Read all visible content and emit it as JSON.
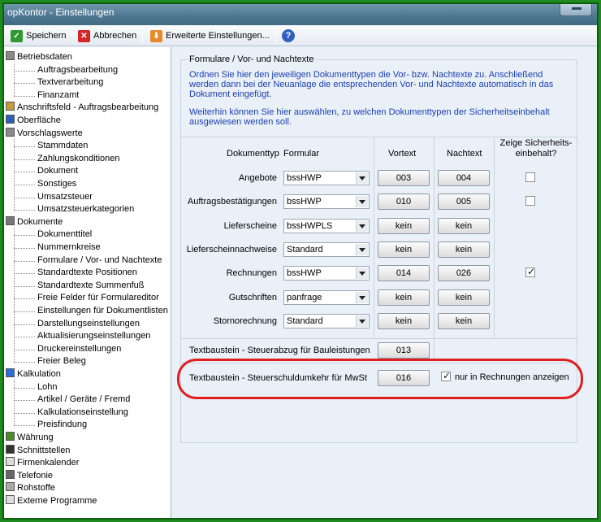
{
  "window": {
    "title": "opKontor - Einstellungen"
  },
  "toolbar": {
    "save_label": "Speichern",
    "cancel_label": "Abbrechen",
    "advanced_label": "Erweiterte Einstellungen...",
    "help_icon": "?"
  },
  "tree": {
    "items": [
      {
        "label": "Betriebsdaten"
      },
      {
        "label": "Auftragsbearbeitung"
      },
      {
        "label": "Textverarbeitung"
      },
      {
        "label": "Finanzamt"
      },
      {
        "label": "Anschriftsfeld - Auftragsbearbeitung"
      },
      {
        "label": "Oberfläche"
      },
      {
        "label": "Vorschlagswerte"
      },
      {
        "label": "Stammdaten"
      },
      {
        "label": "Zahlungskonditionen"
      },
      {
        "label": "Dokument"
      },
      {
        "label": "Sonstiges"
      },
      {
        "label": "Umsatzsteuer"
      },
      {
        "label": "Umsatzsteuerkategorien"
      },
      {
        "label": "Dokumente"
      },
      {
        "label": "Dokumenttitel"
      },
      {
        "label": "Nummernkreise"
      },
      {
        "label": "Formulare / Vor- und Nachtexte"
      },
      {
        "label": "Standardtexte Positionen"
      },
      {
        "label": "Standardtexte Summenfuß"
      },
      {
        "label": "Freie Felder für Formulareditor"
      },
      {
        "label": "Einstellungen für Dokumentlisten"
      },
      {
        "label": "Darstellungseinstellungen"
      },
      {
        "label": "Aktualisierungseinstellungen"
      },
      {
        "label": "Druckereinstellungen"
      },
      {
        "label": "Freier Beleg"
      },
      {
        "label": "Kalkulation"
      },
      {
        "label": "Lohn"
      },
      {
        "label": "Artikel / Geräte / Fremd"
      },
      {
        "label": "Kalkulationseinstellung"
      },
      {
        "label": "Preisfindung"
      },
      {
        "label": "Währung"
      },
      {
        "label": "Schnittstellen"
      },
      {
        "label": "Firmenkalender"
      },
      {
        "label": "Telefonie"
      },
      {
        "label": "Rohstoffe"
      },
      {
        "label": "Externe Programme"
      }
    ]
  },
  "panel": {
    "group_title": "Formulare / Vor- und Nachtexte",
    "desc1": "Ordnen Sie hier den jeweiligen Dokumenttypen die Vor- bzw. Nachtexte zu. Anschließend werden dann bei der Neuanlage die entsprechenden Vor- und Nachtexte automatisch in das Dokument eingefügt.",
    "desc2": "Weiterhin können Sie hier auswählen, zu welchen Dokumenttypen der Sicherheitseinbehalt ausgewiesen werden soll.",
    "headers": {
      "doctype": "Dokumenttyp",
      "formular": "Formular",
      "vortext": "Vortext",
      "nachtext": "Nachtext",
      "zeige": "Zeige Sicherheits-",
      "zeige2": "einbehalt?"
    },
    "rows": [
      {
        "type": "Angebote",
        "form": "bssHWP",
        "vor": "003",
        "nach": "004",
        "checked": false
      },
      {
        "type": "Auftragsbestätigungen",
        "form": "bssHWP",
        "vor": "010",
        "nach": "005",
        "checked": false
      },
      {
        "type": "Lieferscheine",
        "form": "bssHWPLS",
        "vor": "kein",
        "nach": "kein"
      },
      {
        "type": "Lieferscheinnachweise",
        "form": "Standard",
        "vor": "kein",
        "nach": "kein"
      },
      {
        "type": "Rechnungen",
        "form": "bssHWP",
        "vor": "014",
        "nach": "026",
        "checked": true
      },
      {
        "type": "Gutschriften",
        "form": "panfrage",
        "vor": "kein",
        "nach": "kein"
      },
      {
        "type": "Stornorechnung",
        "form": "Standard",
        "vor": "kein",
        "nach": "kein"
      }
    ],
    "bau": {
      "label": "Textbaustein - Steuerabzug für Bauleistungen",
      "value": "013"
    },
    "mwst": {
      "label": "Textbaustein - Steuerschuldumkehr für MwSt",
      "value": "016",
      "check_label": "nur in Rechnungen anzeigen",
      "checked": true
    }
  }
}
